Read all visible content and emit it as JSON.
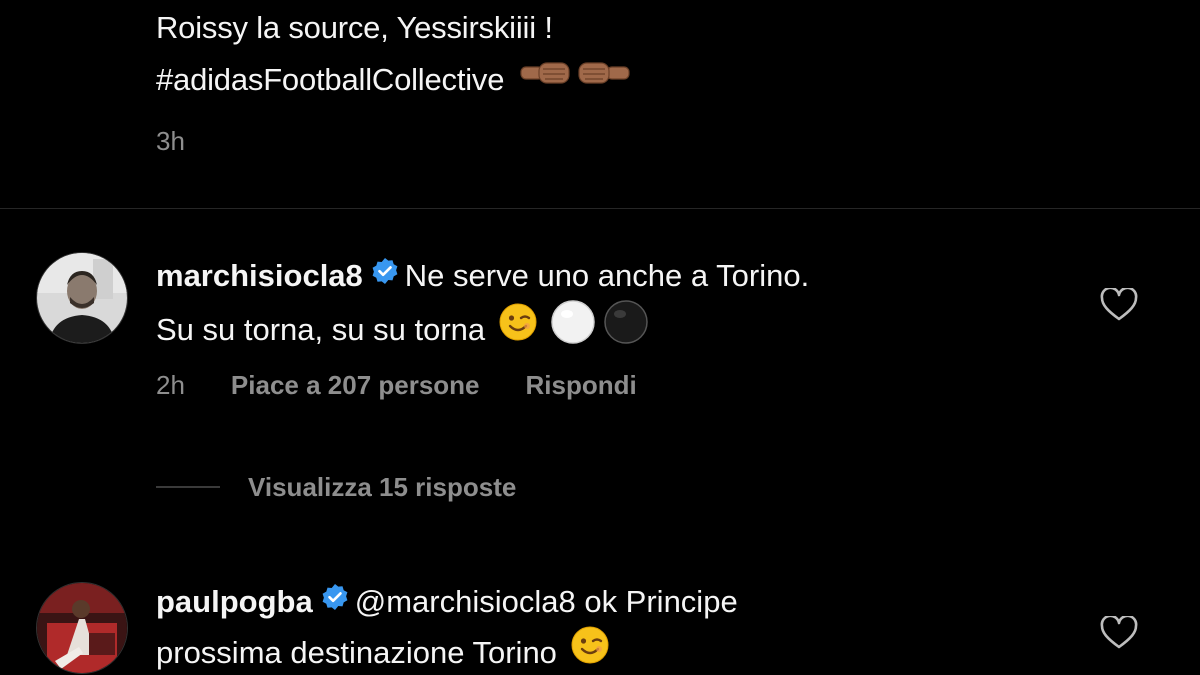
{
  "post": {
    "caption_line1": "Roissy la source, Yessirskiiii !",
    "caption_line2": "#adidasFootballCollective",
    "caption_emoji": "fist-bump-emoji",
    "time": "3h"
  },
  "comments": [
    {
      "username": "marchisiocla8",
      "verified": true,
      "text_line1": "Ne serve uno anche a Torino.",
      "text_line2": "Su su torna, su su torna",
      "emojis": [
        "wink-emoji",
        "white-circle-emoji",
        "black-circle-emoji"
      ],
      "time": "2h",
      "likes": "Piace a 207 persone",
      "reply": "Rispondi",
      "view_replies": "Visualizza 15 risposte"
    },
    {
      "username": "paulpogba",
      "verified": true,
      "mention": "@marchisiocla8",
      "text_line1_rest": "ok Principe",
      "text_line2": "prossima destinazione Torino",
      "emojis": [
        "wink-emoji"
      ]
    }
  ],
  "colors": {
    "background": "#000000",
    "text": "#f5f5f5",
    "muted": "#8e8e8e",
    "verified_blue": "#3897f0",
    "divider": "#262626"
  }
}
